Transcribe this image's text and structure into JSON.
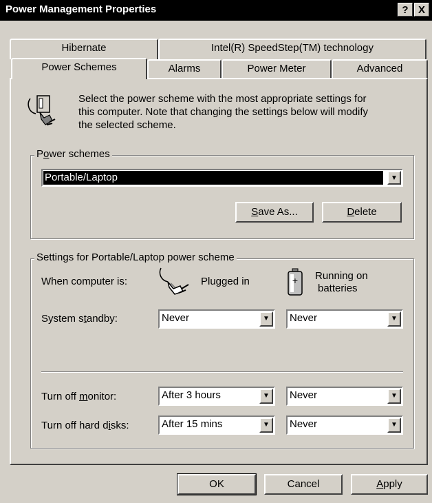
{
  "window": {
    "title": "Power Management Properties"
  },
  "titlebar_buttons": {
    "help": "?",
    "close": "X"
  },
  "tabs_back": [
    "Hibernate",
    "Intel(R) SpeedStep(TM) technology"
  ],
  "tabs_front": [
    "Power Schemes",
    "Alarms",
    "Power Meter",
    "Advanced"
  ],
  "active_tab": "Power Schemes",
  "intro": {
    "line1": "Select the power scheme with the most appropriate settings for",
    "line2": "this computer. Note that changing the settings below will modify",
    "line3": "the selected scheme."
  },
  "power_schemes": {
    "label_pre": "P",
    "label_ul": "o",
    "label_post": "wer schemes",
    "selected": "Portable/Laptop",
    "save_as": {
      "ul": "S",
      "rest": "ave As..."
    },
    "delete": {
      "ul": "D",
      "rest": "elete"
    }
  },
  "settings": {
    "group_label": "Settings for Portable/Laptop power scheme",
    "when_label": "When computer is:",
    "plugged_label": "Plugged in",
    "batteries_line1": "Running on",
    "batteries_line2": "batteries",
    "standby": {
      "pre": "System s",
      "ul": "t",
      "post": "andby:",
      "plugged": "Never",
      "batteries": "Never"
    },
    "monitor": {
      "pre": "Turn off ",
      "ul": "m",
      "post": "onitor:",
      "plugged": "After 3 hours",
      "batteries": "Never"
    },
    "disks": {
      "pre": "Turn off hard d",
      "ul": "i",
      "post": "sks:",
      "plugged": "After 15 mins",
      "batteries": "Never"
    }
  },
  "buttons": {
    "ok": "OK",
    "cancel": "Cancel",
    "apply_ul": "A",
    "apply_rest": "pply"
  }
}
